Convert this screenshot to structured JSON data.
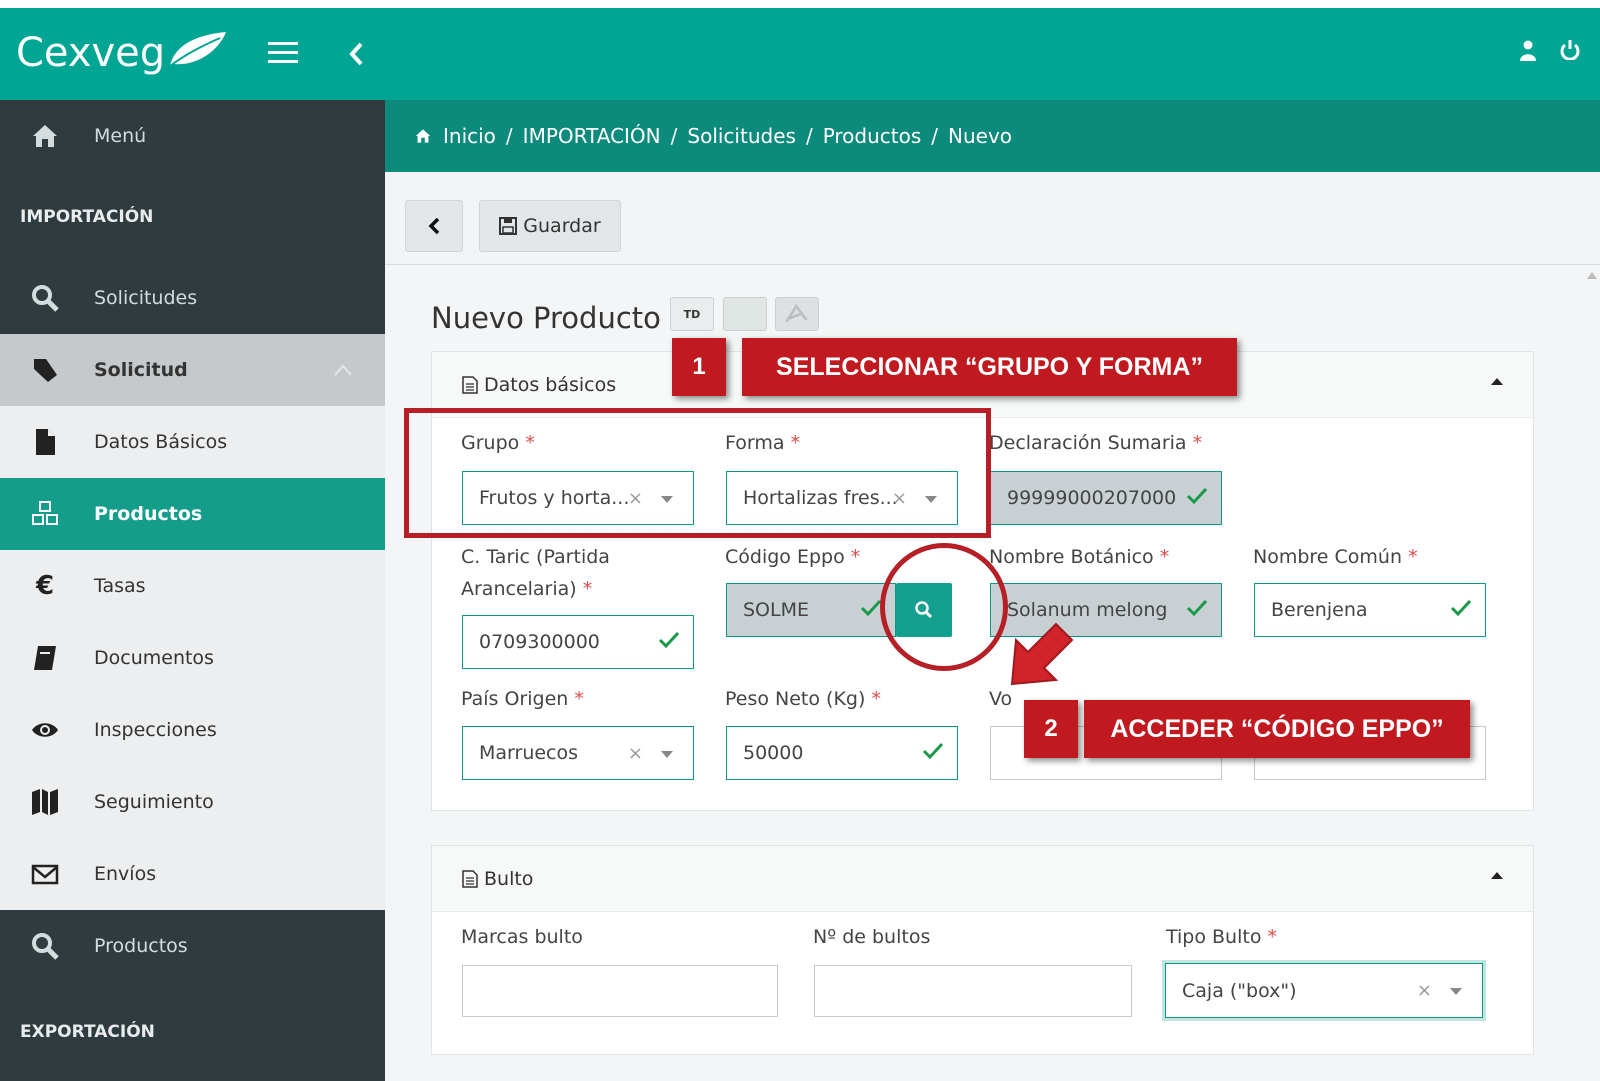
{
  "app": {
    "logo": "Cexveg",
    "colors": {
      "brand": "#01a593",
      "sidebar_dark": "#2f3b3e",
      "active": "#159d8b",
      "annotation": "#c0191f"
    }
  },
  "topbar": {
    "menu_icon": "hamburger-icon",
    "collapse_icon": "chevron-left-icon",
    "user_icon": "user-icon",
    "power_icon": "power-icon"
  },
  "sidebar": {
    "menu": "Menú",
    "section_import": "IMPORTACIÓN",
    "solicitudes": "Solicitudes",
    "solicitud": "Solicitud",
    "datos_basicos": "Datos Básicos",
    "productos_active": "Productos",
    "tasas": "Tasas",
    "documentos": "Documentos",
    "inspecciones": "Inspecciones",
    "seguimiento": "Seguimiento",
    "envios": "Envíos",
    "productos": "Productos",
    "section_export": "EXPORTACIÓN"
  },
  "breadcrumb": {
    "items": [
      "Inicio",
      "/",
      "IMPORTACIÓN",
      "/",
      "Solicitudes",
      "/",
      "Productos",
      "/",
      "Nuevo"
    ]
  },
  "toolbar": {
    "save_label": "Guardar"
  },
  "page": {
    "title": "Nuevo Producto",
    "tag_td": "TD"
  },
  "datos_basicos": {
    "title": "Datos básicos",
    "grupo_label": "Grupo",
    "grupo_value": "Frutos y horta...",
    "forma_label": "Forma",
    "forma_value": "Hortalizas fres...",
    "declaracion_label": "Declaración Sumaria",
    "declaracion_value": "99999000207000",
    "taric_label_1": "C. Taric (Partida",
    "taric_label_2": "Arancelaria)",
    "taric_value": "0709300000",
    "eppo_label": "Código Eppo",
    "eppo_value": "SOLME",
    "botanico_label": "Nombre Botánico",
    "botanico_value": "Solanum melong",
    "comun_label": "Nombre Común",
    "comun_value": "Berenjena",
    "pais_label": "País Origen",
    "pais_value": "Marruecos",
    "peso_label": "Peso Neto (Kg)",
    "peso_value": "50000",
    "vo_label": "Vo",
    "required_mark": "*",
    "clear_mark": "×"
  },
  "bulto": {
    "title": "Bulto",
    "marcas_label": "Marcas bulto",
    "num_label": "Nº de bultos",
    "tipo_label": "Tipo Bulto",
    "tipo_value": "Caja (\"box\")"
  },
  "annotations": {
    "step1_num": "1",
    "step1_text": "SELECCIONAR “GRUPO Y FORMA”",
    "step2_num": "2",
    "step2_text": "ACCEDER “CÓDIGO EPPO”"
  }
}
